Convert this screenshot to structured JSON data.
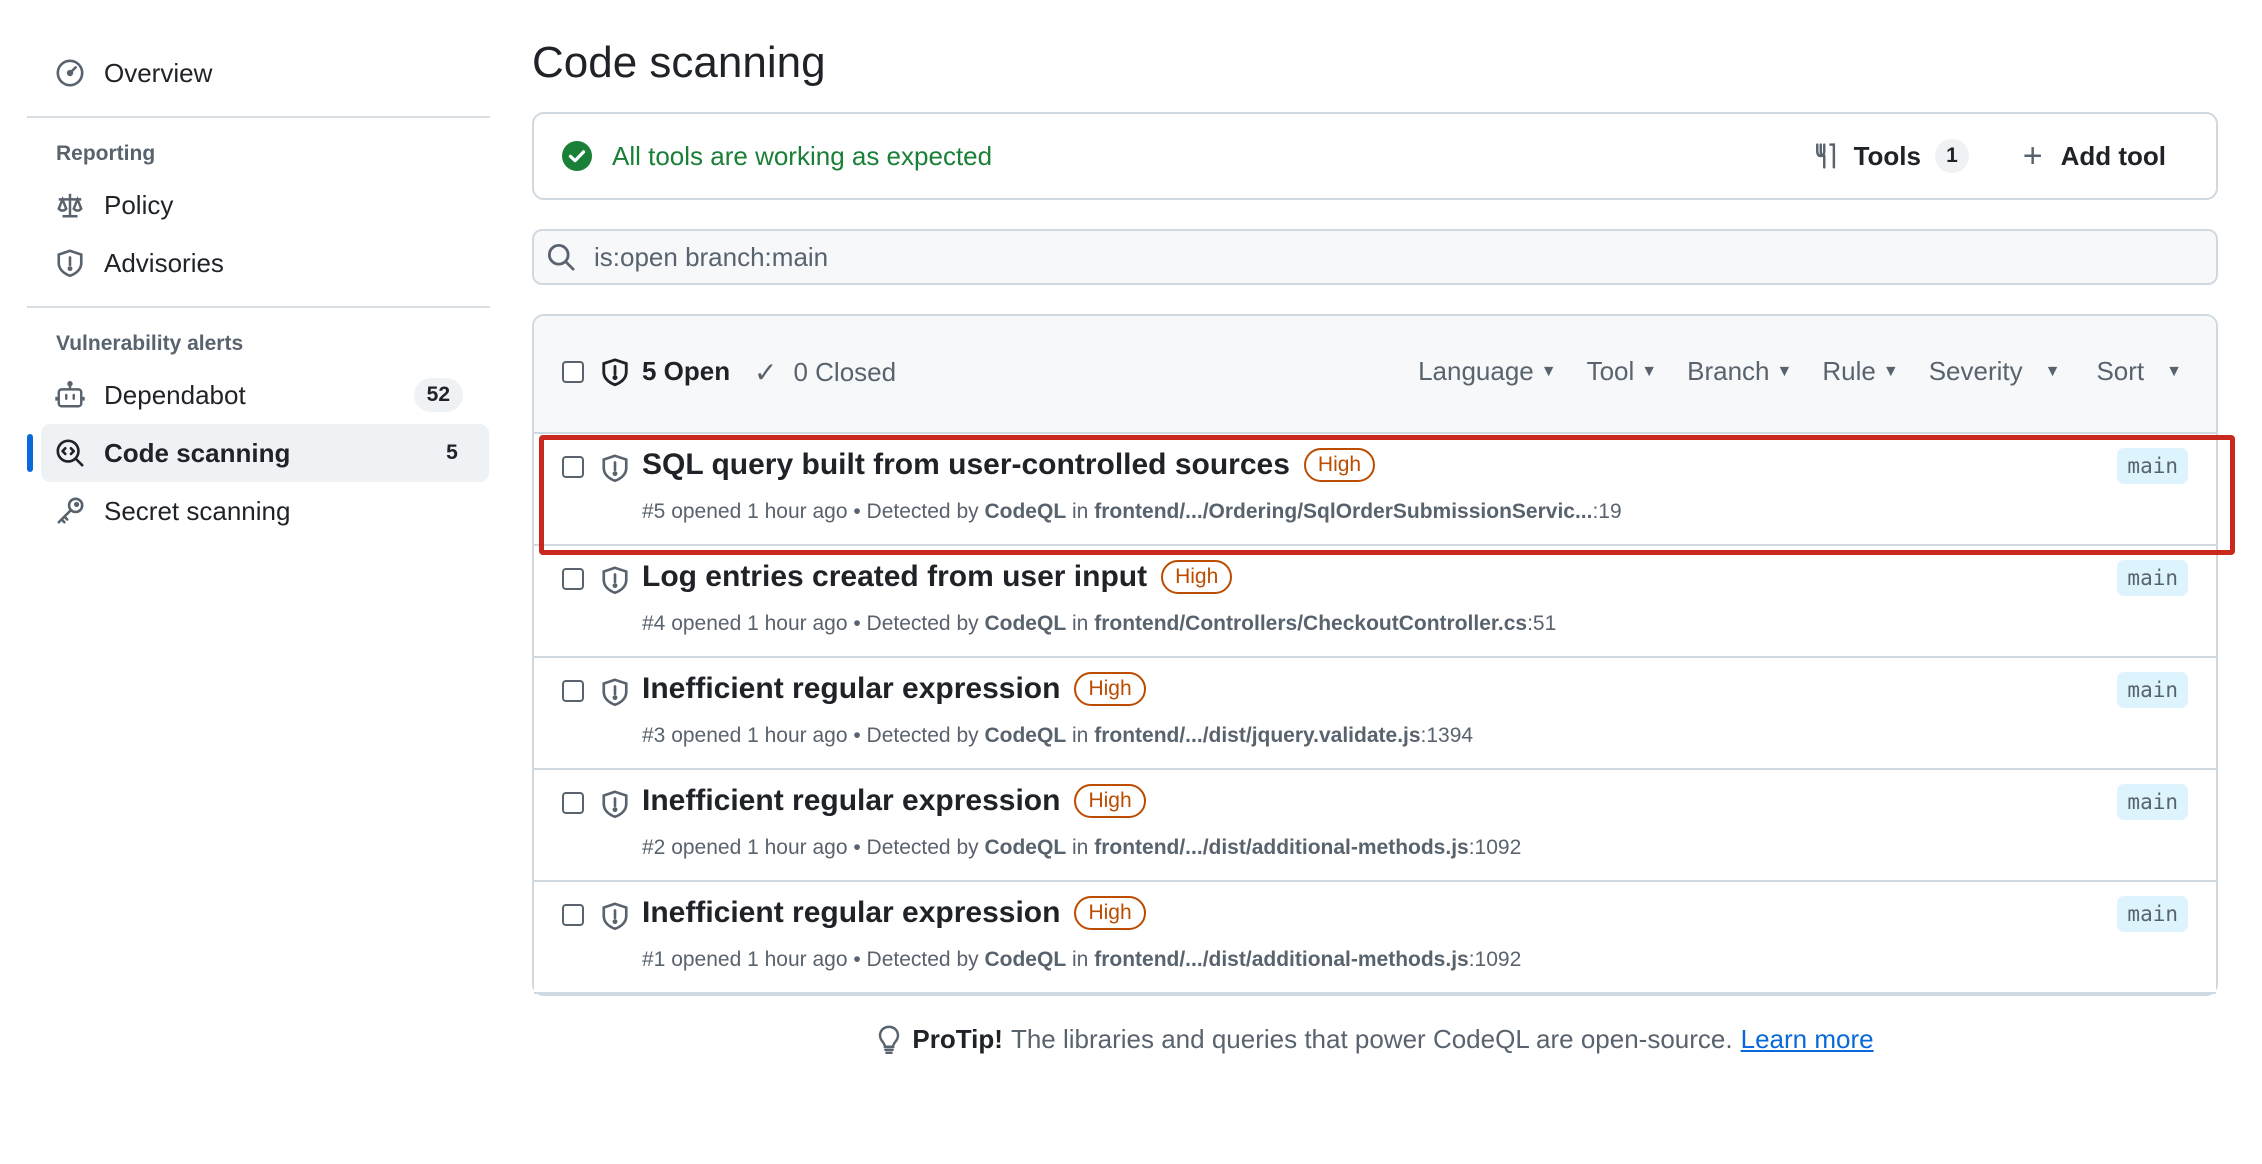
{
  "sidebar": {
    "overview_label": "Overview",
    "reporting_heading": "Reporting",
    "reporting_items": [
      {
        "label": "Policy",
        "icon": "law-icon"
      },
      {
        "label": "Advisories",
        "icon": "shield-icon"
      }
    ],
    "vuln_heading": "Vulnerability alerts",
    "vuln_items": [
      {
        "label": "Dependabot",
        "count": "52",
        "icon": "dependabot-icon"
      },
      {
        "label": "Code scanning",
        "count": "5",
        "icon": "codescan-icon",
        "active": true
      },
      {
        "label": "Secret scanning",
        "icon": "key-icon"
      }
    ]
  },
  "main": {
    "title": "Code scanning",
    "status": {
      "message": "All tools are working as expected",
      "tools_label": "Tools",
      "tools_count": "1",
      "add_tool_label": "Add tool"
    },
    "search": {
      "value": "is:open branch:main"
    },
    "alerts_header": {
      "open_label": "5 Open",
      "closed_label": "0 Closed",
      "filters": [
        "Language",
        "Tool",
        "Branch",
        "Rule",
        "Severity",
        "Sort"
      ]
    },
    "alerts": [
      {
        "title": "SQL query built from user-controlled sources",
        "severity": "High",
        "number": "#5",
        "opened": "opened 1 hour ago",
        "detected_by": "CodeQL",
        "path": "frontend/.../Ordering/SqlOrderSubmissionServic...",
        "line": ":19",
        "branch": "main",
        "highlighted": true
      },
      {
        "title": "Log entries created from user input",
        "severity": "High",
        "number": "#4",
        "opened": "opened 1 hour ago",
        "detected_by": "CodeQL",
        "path": "frontend/Controllers/CheckoutController.cs",
        "line": ":51",
        "branch": "main"
      },
      {
        "title": "Inefficient regular expression",
        "severity": "High",
        "number": "#3",
        "opened": "opened 1 hour ago",
        "detected_by": "CodeQL",
        "path": "frontend/.../dist/jquery.validate.js",
        "line": ":1394",
        "branch": "main"
      },
      {
        "title": "Inefficient regular expression",
        "severity": "High",
        "number": "#2",
        "opened": "opened 1 hour ago",
        "detected_by": "CodeQL",
        "path": "frontend/.../dist/additional-methods.js",
        "line": ":1092",
        "branch": "main"
      },
      {
        "title": "Inefficient regular expression",
        "severity": "High",
        "number": "#1",
        "opened": "opened 1 hour ago",
        "detected_by": "CodeQL",
        "path": "frontend/.../dist/additional-methods.js",
        "line": ":1092",
        "branch": "main"
      }
    ],
    "protip": {
      "label": "ProTip!",
      "text": "The libraries and queries that power CodeQL are open-source.",
      "link": "Learn more"
    }
  },
  "strings": {
    "detected_by_prefix": "• Detected by",
    "in_word": "in"
  },
  "colors": {
    "accent": "#0969da",
    "success": "#1a7f37",
    "severity_high": "#bc4c00",
    "highlight": "#c8291c"
  }
}
